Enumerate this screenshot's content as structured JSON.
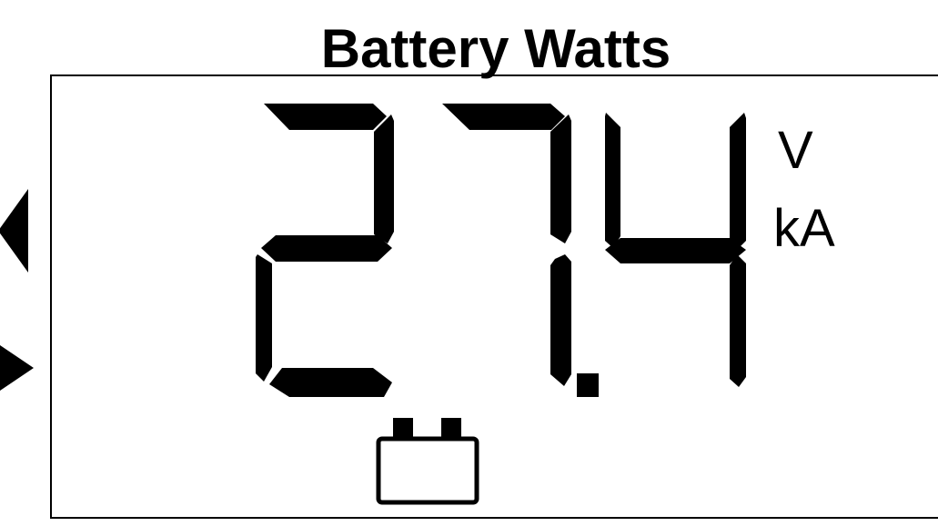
{
  "title": "Battery Watts",
  "display": {
    "reading": "27.4",
    "units": [
      "V",
      "kA"
    ]
  },
  "icons": {
    "prev": "left-triangle-icon",
    "next": "right-triangle-icon",
    "battery": "battery-icon"
  },
  "colors": {
    "segment": "#000000",
    "background": "#ffffff"
  }
}
